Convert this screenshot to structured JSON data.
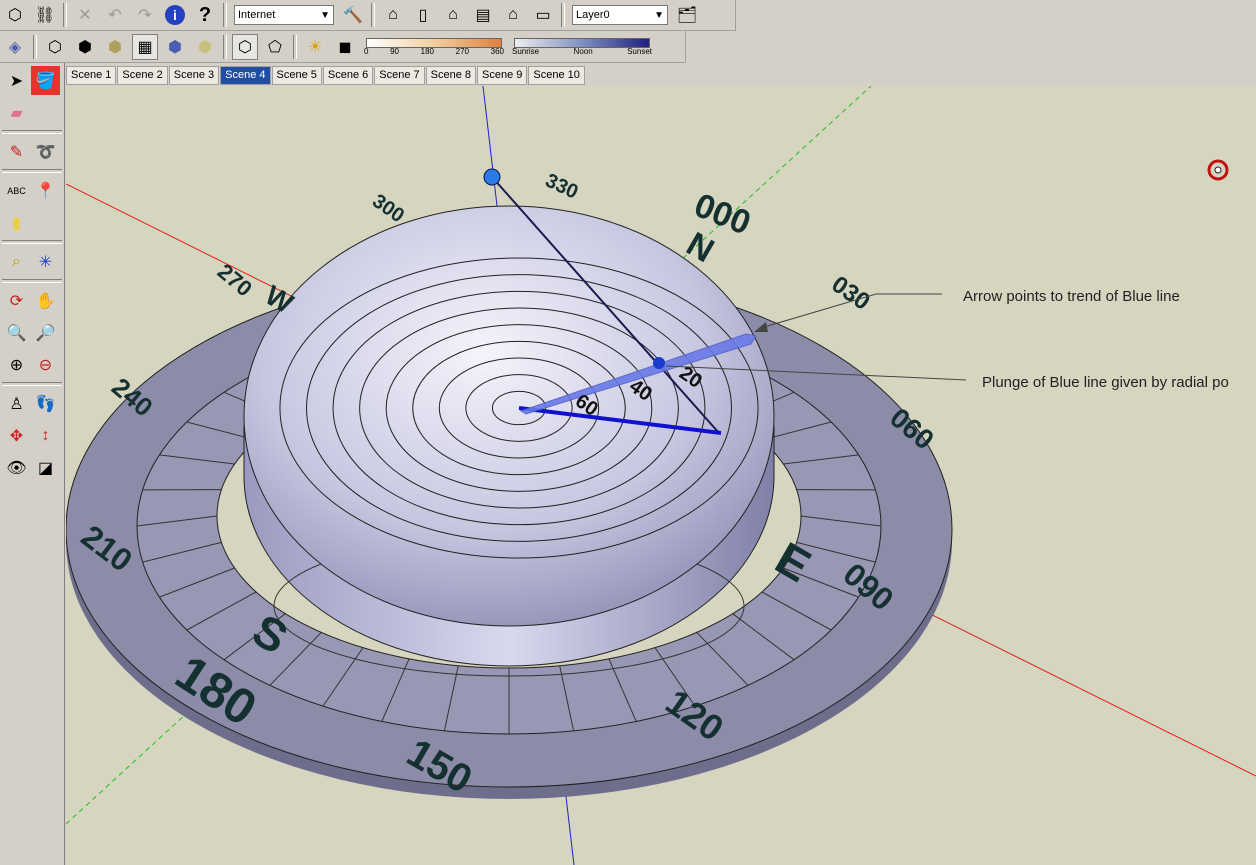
{
  "toolbar1": {
    "style_select": "Internet",
    "layer_select": "Layer0",
    "icons": [
      "cube-wire-icon",
      "link-icon",
      "erase-x-icon",
      "undo-icon",
      "redo-icon",
      "info-icon",
      "help-icon",
      "hammer-icon",
      "house-iso-icon",
      "house-front-icon",
      "house-side-icon",
      "house-back-icon",
      "house-top-icon",
      "house-bottom-icon",
      "layer-manager-icon"
    ]
  },
  "toolbar2": {
    "shadow_scale": {
      "labels": [
        "0",
        "90",
        "180",
        "270",
        "360"
      ]
    },
    "daylight_scale": {
      "labels": [
        "Sunrise",
        "Noon",
        "Sunset"
      ]
    }
  },
  "tabs": [
    "Scene 1",
    "Scene 2",
    "Scene 3",
    "Scene 4",
    "Scene 5",
    "Scene 6",
    "Scene 7",
    "Scene 8",
    "Scene 9",
    "Scene 10"
  ],
  "selected_tab": "Scene 4",
  "model": {
    "bearings": [
      "000",
      "030",
      "060",
      "090",
      "120",
      "150",
      "180",
      "210",
      "240",
      "270",
      "300",
      "330"
    ],
    "cardinals": [
      "N",
      "E",
      "S",
      "W"
    ],
    "plunge_labels": [
      "20",
      "40",
      "60"
    ],
    "annotation_trend": "Arrow points to trend of Blue line",
    "annotation_plunge": "Plunge of Blue line given by radial po"
  },
  "colors": {
    "background": "#d6d5bf",
    "ring": "#8c8ca8",
    "dome": "#c6c6e0",
    "red_axis": "#e02020",
    "green_axis": "#20c020",
    "blue_axis": "#2020d0",
    "selected_tab": "#1f4ea3"
  }
}
